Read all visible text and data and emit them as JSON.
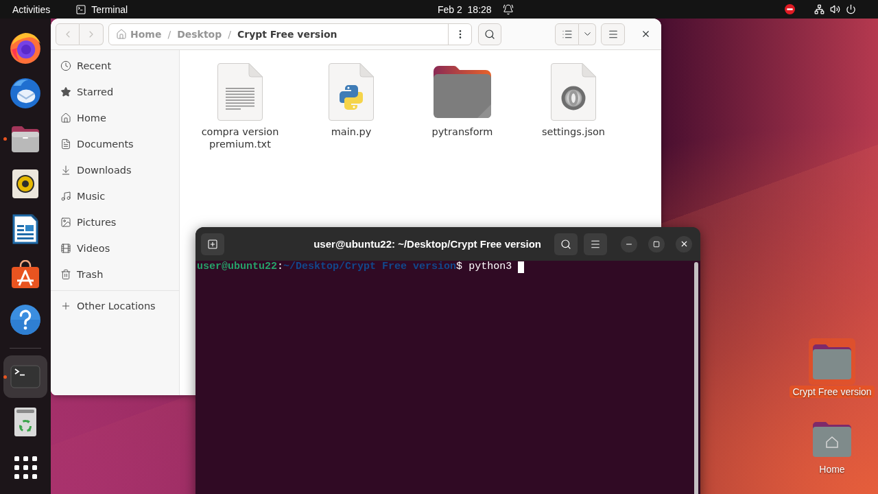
{
  "top_bar": {
    "activities": "Activities",
    "app_menu": "Terminal",
    "clock": "Feb 2  18:28"
  },
  "dock": {
    "favorites": [
      {
        "kind": "browser",
        "running": false,
        "selected": false
      },
      {
        "kind": "mail",
        "running": false,
        "selected": false
      },
      {
        "kind": "files",
        "running": true,
        "selected": false
      },
      {
        "kind": "music",
        "running": false,
        "selected": false
      },
      {
        "kind": "writer",
        "running": false,
        "selected": false
      },
      {
        "kind": "software",
        "running": false,
        "selected": false
      },
      {
        "kind": "help",
        "running": false,
        "selected": false
      }
    ],
    "others": [
      {
        "kind": "terminal",
        "running": true,
        "selected": true
      },
      {
        "kind": "trash",
        "running": false,
        "selected": false
      }
    ]
  },
  "file_manager": {
    "back": {
      "disabled": true
    },
    "forward": {
      "disabled": true
    },
    "path": [
      {
        "kind": "home",
        "label": "Home",
        "selected": false
      },
      {
        "kind": "folder",
        "separator": "/",
        "label": "Desktop",
        "selected": false
      },
      {
        "kind": "folder",
        "separator": "/",
        "label": "Crypt Free version",
        "selected": true
      }
    ],
    "sidebar": {
      "places": [
        {
          "kind": "recent",
          "label": "Recent",
          "selected": false
        },
        {
          "kind": "starred",
          "label": "Starred",
          "selected": false
        },
        {
          "kind": "home",
          "label": "Home",
          "selected": false
        },
        {
          "kind": "documents",
          "label": "Documents",
          "selected": false
        },
        {
          "kind": "downloads",
          "label": "Downloads",
          "selected": false
        },
        {
          "kind": "music",
          "label": "Music",
          "selected": false
        },
        {
          "kind": "pictures",
          "label": "Pictures",
          "selected": false
        },
        {
          "kind": "videos",
          "label": "Videos",
          "selected": false
        },
        {
          "kind": "trash",
          "label": "Trash",
          "selected": false
        }
      ],
      "other": [
        {
          "kind": "other",
          "label": "Other Locations",
          "selected": false
        }
      ]
    },
    "files": [
      {
        "kind": "text",
        "name": "compra version premium.txt",
        "selected": false
      },
      {
        "kind": "python",
        "name": "main.py",
        "selected": false
      },
      {
        "kind": "folder",
        "name": "pytransform",
        "selected": false
      },
      {
        "kind": "json",
        "name": "settings.json",
        "selected": false
      }
    ]
  },
  "terminal": {
    "title": "user@ubuntu22: ~/Desktop/Crypt Free version",
    "prompt": {
      "user_host": "user@ubuntu22",
      "colon": ":",
      "path": "~/Desktop/Crypt Free version",
      "symbol": "$"
    },
    "command": "python3"
  },
  "desktop_icons": [
    {
      "kind": "folder",
      "label": "Crypt Free version",
      "selected": true
    },
    {
      "kind": "home",
      "label": "Home",
      "selected": false
    }
  ]
}
